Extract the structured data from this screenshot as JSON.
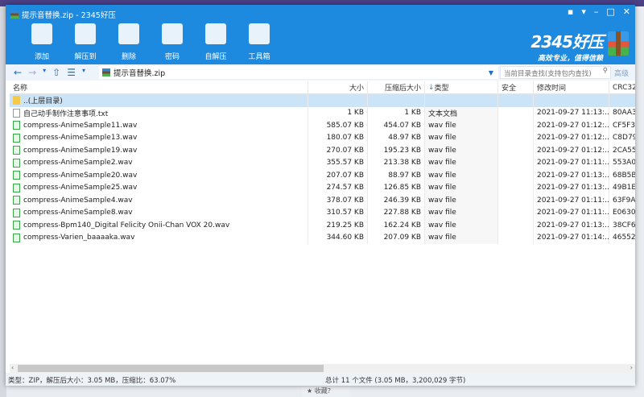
{
  "window": {
    "title": "提示音替换.zip - 2345好压"
  },
  "toolbar": [
    {
      "label": "添加",
      "icon": "add-archive-icon"
    },
    {
      "label": "解压到",
      "icon": "extract-icon"
    },
    {
      "label": "删除",
      "icon": "recycle-bin-icon"
    },
    {
      "label": "密码",
      "icon": "lock-icon"
    },
    {
      "label": "自解压",
      "icon": "sfx-icon"
    },
    {
      "label": "工具箱",
      "icon": "toolbox-icon"
    }
  ],
  "logo": {
    "name": "2345好压",
    "slogan": "高效专业，值得信赖"
  },
  "address": {
    "path": "提示音替换.zip",
    "search_placeholder": "当前目录查找(支持包内查找)",
    "advanced": "高级"
  },
  "columns": [
    "名称",
    "大小",
    "压缩后大小",
    "类型",
    "安全",
    "修改时间",
    "CRC32"
  ],
  "rows": [
    {
      "name": "..(上层目录)",
      "size": "",
      "packed": "",
      "type": "",
      "modified": "",
      "crc": "",
      "icon": "folder"
    },
    {
      "name": "自己动手制作注意事项.txt",
      "size": "1 KB",
      "packed": "1 KB",
      "type": "文本文档",
      "modified": "2021-09-27 11:13:...",
      "crc": "80AA3",
      "icon": "txt"
    },
    {
      "name": "compress-AnimeSample11.wav",
      "size": "585.07 KB",
      "packed": "454.07 KB",
      "type": "wav file",
      "modified": "2021-09-27 01:12:...",
      "crc": "CF5F3",
      "icon": "wav"
    },
    {
      "name": "compress-AnimeSample13.wav",
      "size": "180.07 KB",
      "packed": "48.97 KB",
      "type": "wav file",
      "modified": "2021-09-27 01:12:...",
      "crc": "C8D79",
      "icon": "wav"
    },
    {
      "name": "compress-AnimeSample19.wav",
      "size": "270.07 KB",
      "packed": "195.23 KB",
      "type": "wav file",
      "modified": "2021-09-27 01:12:...",
      "crc": "2CA55",
      "icon": "wav"
    },
    {
      "name": "compress-AnimeSample2.wav",
      "size": "355.57 KB",
      "packed": "213.38 KB",
      "type": "wav file",
      "modified": "2021-09-27 01:11:...",
      "crc": "553A0",
      "icon": "wav"
    },
    {
      "name": "compress-AnimeSample20.wav",
      "size": "207.07 KB",
      "packed": "88.97 KB",
      "type": "wav file",
      "modified": "2021-09-27 01:13:...",
      "crc": "68B5B",
      "icon": "wav"
    },
    {
      "name": "compress-AnimeSample25.wav",
      "size": "274.57 KB",
      "packed": "126.85 KB",
      "type": "wav file",
      "modified": "2021-09-27 01:13:...",
      "crc": "49B1E",
      "icon": "wav"
    },
    {
      "name": "compress-AnimeSample4.wav",
      "size": "378.07 KB",
      "packed": "246.39 KB",
      "type": "wav file",
      "modified": "2021-09-27 01:11:...",
      "crc": "63F9A",
      "icon": "wav"
    },
    {
      "name": "compress-AnimeSample8.wav",
      "size": "310.57 KB",
      "packed": "227.88 KB",
      "type": "wav file",
      "modified": "2021-09-27 01:11:...",
      "crc": "E0630",
      "icon": "wav"
    },
    {
      "name": "compress-Bpm140_Digital Felicity Onii-Chan VOX 20.wav",
      "size": "219.25 KB",
      "packed": "162.24 KB",
      "type": "wav file",
      "modified": "2021-09-27 01:13:...",
      "crc": "38CF6",
      "icon": "wav"
    },
    {
      "name": "compress-Varien_baaaaka.wav",
      "size": "344.60 KB",
      "packed": "207.09 KB",
      "type": "wav file",
      "modified": "2021-09-27 01:14:...",
      "crc": "46552",
      "icon": "wav"
    }
  ],
  "status": {
    "left": "类型：ZIP，解压后大小：3.05 MB，压缩比：63.07%",
    "right": "总计 11 个文件 (3.05 MB，3,200,029 字节)"
  },
  "background": {
    "taskbar_text": "收藏？"
  },
  "colors": {
    "brand": "#1d8ae0",
    "selected_row": "#cce4f7"
  }
}
